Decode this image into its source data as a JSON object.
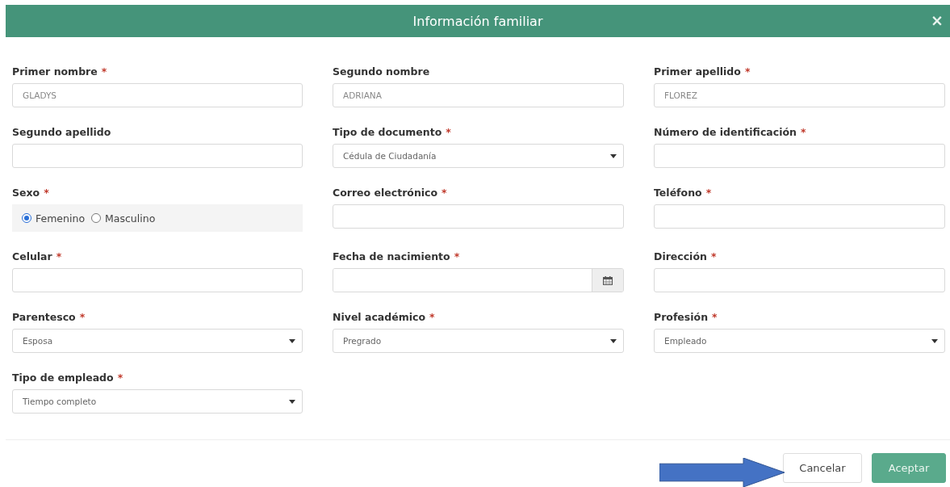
{
  "dialog": {
    "title": "Información familiar",
    "close": "×"
  },
  "fields": [
    {
      "kind": "text",
      "label": "Primer nombre",
      "required_mark": "*",
      "value": "GLADYS"
    },
    {
      "kind": "text",
      "label": "Segundo nombre",
      "value": "ADRIANA"
    },
    {
      "kind": "text",
      "label": "Primer apellido",
      "required_mark": "*",
      "value": "FLOREZ"
    },
    {
      "kind": "text",
      "label": "Segundo apellido"
    },
    {
      "kind": "select",
      "label": "Tipo de documento",
      "required_mark": "*",
      "value": "Cédula de Ciudadanía"
    },
    {
      "kind": "text",
      "label": "Número de identificación",
      "required_mark": "*"
    },
    {
      "kind": "radio",
      "label": "Sexo",
      "required_mark": "*",
      "options": [
        {
          "label": "Femenino",
          "selected": true
        },
        {
          "label": "Masculino",
          "selected": false
        }
      ]
    },
    {
      "kind": "text",
      "label": "Correo electrónico",
      "required_mark": "*"
    },
    {
      "kind": "text",
      "label": "Teléfono",
      "required_mark": "*"
    },
    {
      "kind": "text",
      "label": "Celular",
      "required_mark": "*"
    },
    {
      "kind": "date",
      "label": "Fecha de nacimiento",
      "required_mark": "*"
    },
    {
      "kind": "text",
      "label": "Dirección",
      "required_mark": "*"
    },
    {
      "kind": "select",
      "label": "Parentesco",
      "required_mark": "*",
      "value": "Esposa"
    },
    {
      "kind": "select",
      "label": "Nivel académico",
      "required_mark": "*",
      "value": "Pregrado"
    },
    {
      "kind": "select",
      "label": "Profesión",
      "required_mark": "*",
      "value": "Empleado"
    },
    {
      "kind": "select",
      "label": "Tipo de empleado",
      "required_mark": "*",
      "value": "Tiempo completo"
    }
  ],
  "buttons": [
    {
      "label": "Cancelar",
      "kind": "secondary"
    },
    {
      "label": "Aceptar",
      "kind": "primary"
    }
  ]
}
